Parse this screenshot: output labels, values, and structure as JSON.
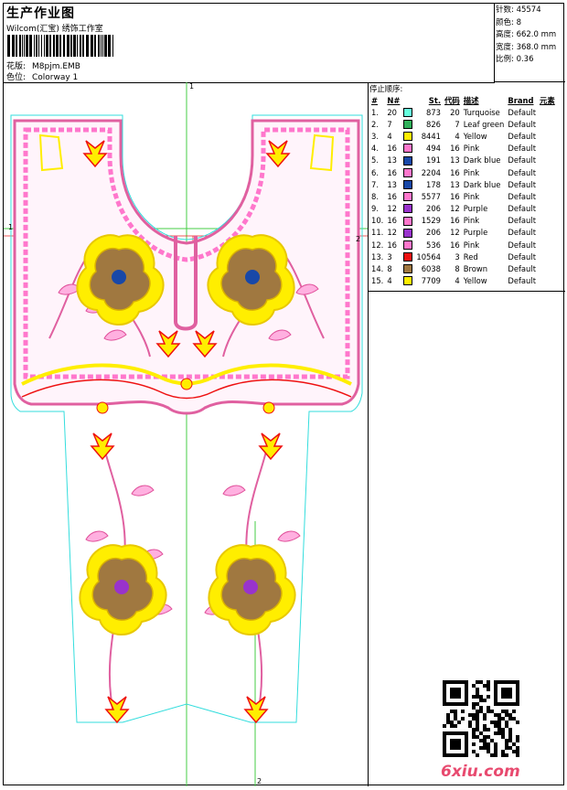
{
  "header": {
    "title": "生产作业图",
    "company": "Wilcom(汇宝) 绣饰工作室",
    "design_label": "花版:",
    "design_value": "M8pjm.EMB",
    "colorway_label": "色位:",
    "colorway_value": "Colorway 1"
  },
  "stats": {
    "stitches": "针数: 45574",
    "colors": "颜色: 8",
    "height": "高度: 662.0 mm",
    "width": "宽度: 368.0 mm",
    "scale": "比例: 0.36"
  },
  "legend": {
    "heading": "停止顺序:",
    "columns": [
      "#",
      "N#",
      "St.",
      "代码",
      "描述",
      "Brand",
      "元素"
    ],
    "rows": [
      {
        "idx": "1.",
        "n": "20",
        "color": "#66ffdd",
        "st": "873",
        "code": "20",
        "desc": "Turquoise",
        "brand": "Default"
      },
      {
        "idx": "2.",
        "n": "7",
        "color": "#2fb05a",
        "st": "826",
        "code": "7",
        "desc": "Leaf green",
        "brand": "Default"
      },
      {
        "idx": "3.",
        "n": "4",
        "color": "#ffee00",
        "st": "8441",
        "code": "4",
        "desc": "Yellow",
        "brand": "Default"
      },
      {
        "idx": "4.",
        "n": "16",
        "color": "#ff77cc",
        "st": "494",
        "code": "16",
        "desc": "Pink",
        "brand": "Default"
      },
      {
        "idx": "5.",
        "n": "13",
        "color": "#1848a8",
        "st": "191",
        "code": "13",
        "desc": "Dark blue",
        "brand": "Default"
      },
      {
        "idx": "6.",
        "n": "16",
        "color": "#ff77cc",
        "st": "2204",
        "code": "16",
        "desc": "Pink",
        "brand": "Default"
      },
      {
        "idx": "7.",
        "n": "13",
        "color": "#1848a8",
        "st": "178",
        "code": "13",
        "desc": "Dark blue",
        "brand": "Default"
      },
      {
        "idx": "8.",
        "n": "16",
        "color": "#ff77cc",
        "st": "5577",
        "code": "16",
        "desc": "Pink",
        "brand": "Default"
      },
      {
        "idx": "9.",
        "n": "12",
        "color": "#9933cc",
        "st": "206",
        "code": "12",
        "desc": "Purple",
        "brand": "Default"
      },
      {
        "idx": "10.",
        "n": "16",
        "color": "#ff77cc",
        "st": "1529",
        "code": "16",
        "desc": "Pink",
        "brand": "Default"
      },
      {
        "idx": "11.",
        "n": "12",
        "color": "#9933cc",
        "st": "206",
        "code": "12",
        "desc": "Purple",
        "brand": "Default"
      },
      {
        "idx": "12.",
        "n": "16",
        "color": "#ff77cc",
        "st": "536",
        "code": "16",
        "desc": "Pink",
        "brand": "Default"
      },
      {
        "idx": "13.",
        "n": "3",
        "color": "#ee1111",
        "st": "10564",
        "code": "3",
        "desc": "Red",
        "brand": "Default"
      },
      {
        "idx": "14.",
        "n": "8",
        "color": "#a07840",
        "st": "6038",
        "code": "8",
        "desc": "Brown",
        "brand": "Default"
      },
      {
        "idx": "15.",
        "n": "4",
        "color": "#ffee00",
        "st": "7709",
        "code": "4",
        "desc": "Yellow",
        "brand": "Default"
      }
    ]
  },
  "axes": {
    "v_top": "1",
    "h_left": "1",
    "h_right": "2",
    "v_bottom": "2"
  },
  "watermark": "6xiu.com"
}
